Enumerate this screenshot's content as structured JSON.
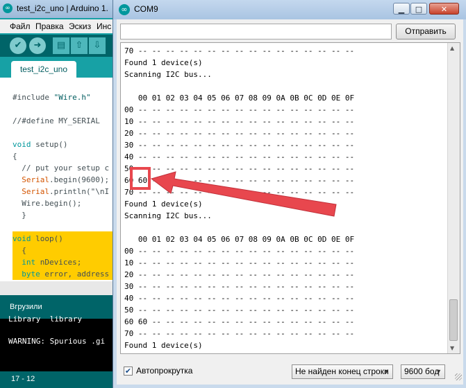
{
  "ide": {
    "title": "test_i2c_uno | Arduino 1.",
    "menu": [
      "Файл",
      "Правка",
      "Эскиз",
      "Инс"
    ],
    "tab": "test_i2c_uno",
    "code": {
      "l1a": "#include ",
      "l1b": "\"Wire.h\"",
      "l2": "//#define MY_SERIAL",
      "l3a": "void",
      "l3b": " setup()",
      "l4": "{",
      "l5": "  // put your setup c",
      "l6a": "  Serial",
      "l6b": ".begin(9600);",
      "l7a": "  Serial",
      "l7b": ".println(\"\\nI",
      "l8": "  Wire.begin();",
      "l9": "  }",
      "l10a": "void",
      "l10b": " loop()",
      "l11": "  {",
      "l12a": "  int",
      "l12b": " nDevices;",
      "l13a": "  byte",
      "l13b": " error, address"
    },
    "status": "Вгрузили",
    "console": [
      "Library  library",
      "",
      "WARNING: Spurious .gi"
    ],
    "footer": "17 - 12"
  },
  "monitor": {
    "title": "COM9",
    "window_buttons": {
      "minimize": "▁",
      "maximize": "□",
      "close": "✕"
    },
    "input_value": "",
    "send_label": "Отправить",
    "output_lines": [
      "70 -- -- -- -- -- -- -- -- -- -- -- -- -- -- -- --",
      "Found 1 device(s)",
      "Scanning I2C bus...",
      "",
      "   00 01 02 03 04 05 06 07 08 09 0A 0B 0C 0D 0E 0F",
      "00 -- -- -- -- -- -- -- -- -- -- -- -- -- -- -- --",
      "10 -- -- -- -- -- -- -- -- -- -- -- -- -- -- -- --",
      "20 -- -- -- -- -- -- -- -- -- -- -- -- -- -- -- --",
      "30 -- -- -- -- -- -- -- -- -- -- -- -- -- -- -- --",
      "40 -- -- -- -- -- -- -- -- -- -- -- -- -- -- -- --",
      "50 -- -- -- -- -- -- -- -- -- -- -- -- -- -- -- --",
      "60 60 -- -- -- -- -- -- -- -- -- -- -- -- -- -- --",
      "70 -- -- -- -- -- -- -- -- -- -- -- -- -- -- -- --",
      "Found 1 device(s)",
      "Scanning I2C bus...",
      "",
      "   00 01 02 03 04 05 06 07 08 09 0A 0B 0C 0D 0E 0F",
      "00 -- -- -- -- -- -- -- -- -- -- -- -- -- -- -- --",
      "10 -- -- -- -- -- -- -- -- -- -- -- -- -- -- -- --",
      "20 -- -- -- -- -- -- -- -- -- -- -- -- -- -- -- --",
      "30 -- -- -- -- -- -- -- -- -- -- -- -- -- -- -- --",
      "40 -- -- -- -- -- -- -- -- -- -- -- -- -- -- -- --",
      "50 -- -- -- -- -- -- -- -- -- -- -- -- -- -- -- --",
      "60 60 -- -- -- -- -- -- -- -- -- -- -- -- -- -- --",
      "70 -- -- -- -- -- -- -- -- -- -- -- -- -- -- -- --",
      "Found 1 device(s)"
    ],
    "autoscroll": {
      "label": "Автопрокрутка",
      "checked": true
    },
    "line_ending": "Не найден конец строки",
    "baud": "9600 бод"
  },
  "annotation": {
    "color": "#e8474e",
    "highlighted_value": "60"
  }
}
